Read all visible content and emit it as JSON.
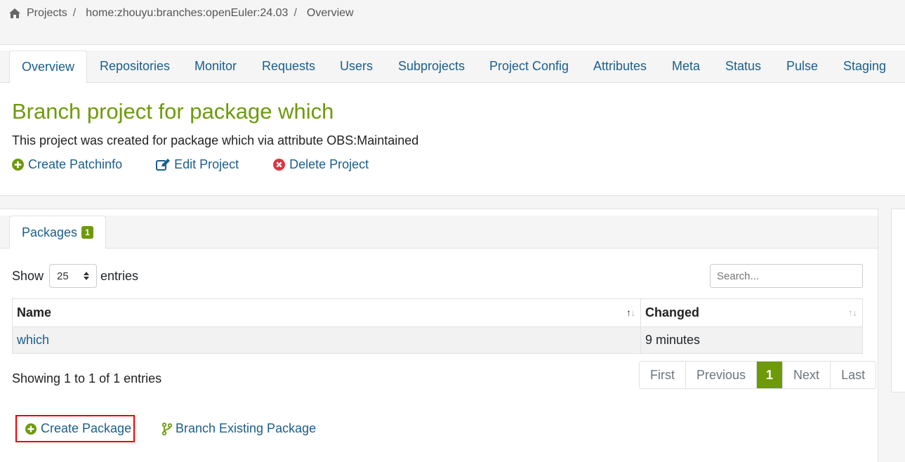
{
  "breadcrumb": {
    "items": [
      "Projects",
      "home:zhouyu:branches:openEuler:24.03",
      "Overview"
    ]
  },
  "tabs": [
    "Overview",
    "Repositories",
    "Monitor",
    "Requests",
    "Users",
    "Subprojects",
    "Project Config",
    "Attributes",
    "Meta",
    "Status",
    "Pulse",
    "Staging"
  ],
  "project": {
    "title": "Branch project for package which",
    "description": "This project was created for package which via attribute OBS:Maintained",
    "actions": [
      "Create Patchinfo",
      "Edit Project",
      "Delete Project"
    ]
  },
  "packages": {
    "tab_label": "Packages",
    "count": "1",
    "show_label": "Show",
    "page_size": "25",
    "entries_label": "entries",
    "search_placeholder": "Search...",
    "columns": [
      "Name",
      "Changed"
    ],
    "rows": [
      {
        "name": "which",
        "changed": "9 minutes"
      }
    ],
    "info": "Showing 1 to 1 of 1 entries",
    "pager": [
      "First",
      "Previous",
      "1",
      "Next",
      "Last"
    ],
    "create_label": "Create Package",
    "branch_label": "Branch Existing Package"
  },
  "colors": {
    "accent_green": "#6d9a0b",
    "link_blue": "#1a5e8c",
    "delete_red": "#dc3545",
    "highlight_red": "#ee0000"
  }
}
